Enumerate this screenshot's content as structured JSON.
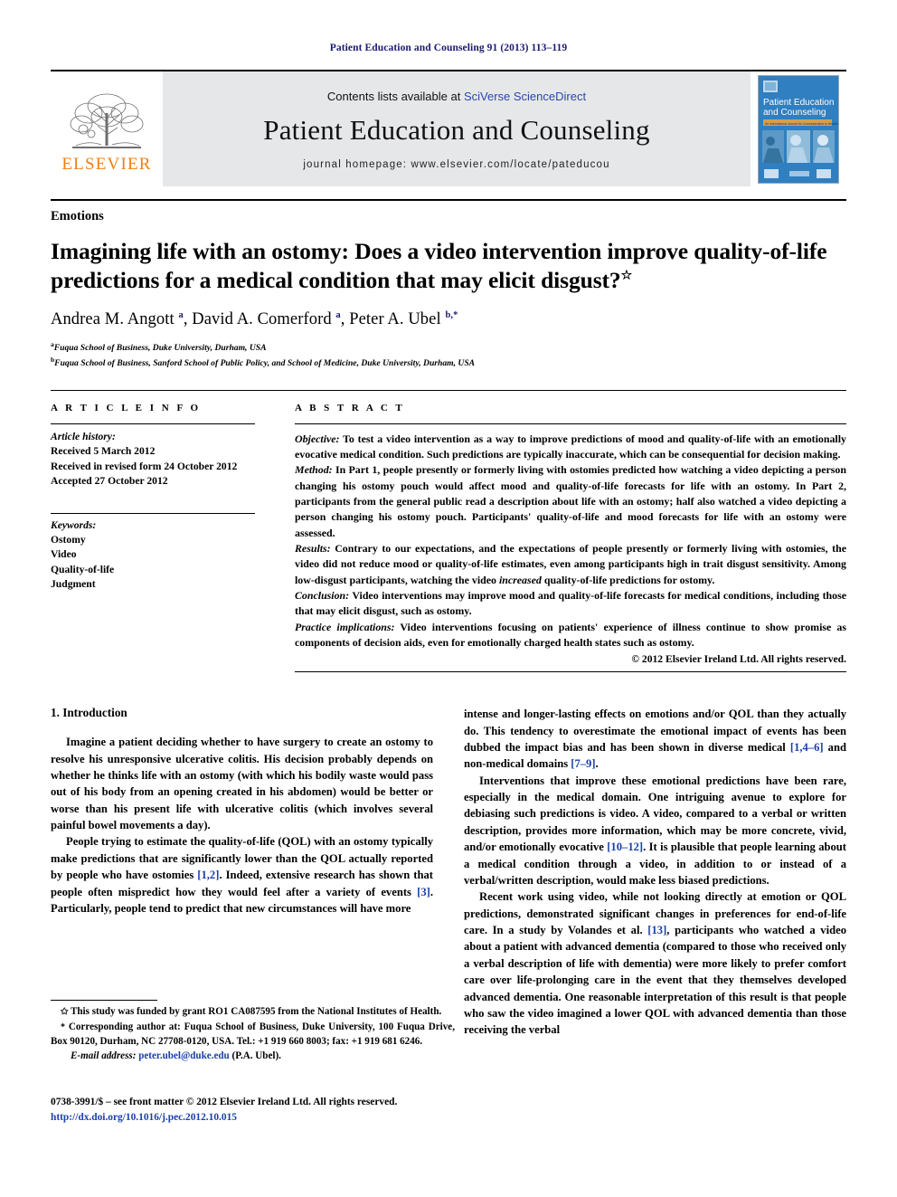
{
  "running_head": "Patient Education and Counseling 91 (2013) 113–119",
  "masthead": {
    "contents_prefix": "Contents lists available at ",
    "sciencedirect": "SciVerse ScienceDirect",
    "journal_title": "Patient Education and Counseling",
    "homepage": "journal homepage: www.elsevier.com/locate/pateducou",
    "publisher_logo_text": "ELSEVIER",
    "cover_title_line1": "Patient Education",
    "cover_title_line2": "and Counseling",
    "cover_subtitle": "An International Journal for Communication in Healthcare"
  },
  "article": {
    "section_label": "Emotions",
    "title": "Imagining life with an ostomy: Does a video intervention improve quality-of-life predictions for a medical condition that may elicit disgust?",
    "title_footnote_marker": "☆",
    "authors_html": "Andrea M. Angott <sup>a</sup>, David A. Comerford <sup>a</sup>, Peter A. Ubel <sup>b,*</sup>",
    "affiliations": [
      {
        "marker": "a",
        "text": "Fuqua School of Business, Duke University, Durham, USA"
      },
      {
        "marker": "b",
        "text": "Fuqua School of Business, Sanford School of Public Policy, and School of Medicine, Duke University, Durham, USA"
      }
    ]
  },
  "article_info": {
    "heading": "A R T I C L E   I N F O",
    "history_label": "Article history:",
    "history": [
      "Received 5 March 2012",
      "Received in revised form 24 October 2012",
      "Accepted 27 October 2012"
    ],
    "keywords_label": "Keywords:",
    "keywords": [
      "Ostomy",
      "Video",
      "Quality-of-life",
      "Judgment"
    ]
  },
  "abstract": {
    "heading": "A B S T R A C T",
    "sections": [
      {
        "label": "Objective:",
        "text": " To test a video intervention as a way to improve predictions of mood and quality-of-life with an emotionally evocative medical condition. Such predictions are typically inaccurate, which can be consequential for decision making."
      },
      {
        "label": "Method:",
        "text": " In Part 1, people presently or formerly living with ostomies predicted how watching a video depicting a person changing his ostomy pouch would affect mood and quality-of-life forecasts for life with an ostomy. In Part 2, participants from the general public read a description about life with an ostomy; half also watched a video depicting a person changing his ostomy pouch. Participants' quality-of-life and mood forecasts for life with an ostomy were assessed."
      },
      {
        "label": "Results:",
        "text": " Contrary to our expectations, and the expectations of people presently or formerly living with ostomies, the video did not reduce mood or quality-of-life estimates, even among participants high in trait disgust sensitivity. Among low-disgust participants, watching the video increased quality-of-life predictions for ostomy.",
        "emphasis": "increased"
      },
      {
        "label": "Conclusion:",
        "text": " Video interventions may improve mood and quality-of-life forecasts for medical conditions, including those that may elicit disgust, such as ostomy."
      },
      {
        "label": "Practice implications:",
        "text": " Video interventions focusing on patients' experience of illness continue to show promise as components of decision aids, even for emotionally charged health states such as ostomy."
      }
    ],
    "copyright": "© 2012 Elsevier Ireland Ltd. All rights reserved."
  },
  "body": {
    "heading": "1. Introduction",
    "left_paragraphs": [
      "Imagine a patient deciding whether to have surgery to create an ostomy to resolve his unresponsive ulcerative colitis. His decision probably depends on whether he thinks life with an ostomy (with which his bodily waste would pass out of his body from an opening created in his abdomen) would be better or worse than his present life with ulcerative colitis (which involves several painful bowel movements a day).",
      "People trying to estimate the quality-of-life (QOL) with an ostomy typically make predictions that are significantly lower than the QOL actually reported by people who have ostomies [1,2]. Indeed, extensive research has shown that people often mispredict how they would feel after a variety of events [3]. Particularly, people tend to predict that new circumstances will have more"
    ],
    "right_paragraphs": [
      "intense and longer-lasting effects on emotions and/or QOL than they actually do. This tendency to overestimate the emotional impact of events has been dubbed the impact bias and has been shown in diverse medical [1,4–6] and non-medical domains [7–9].",
      "Interventions that improve these emotional predictions have been rare, especially in the medical domain. One intriguing avenue to explore for debiasing such predictions is video. A video, compared to a verbal or written description, provides more information, which may be more concrete, vivid, and/or emotionally evocative [10–12]. It is plausible that people learning about a medical condition through a video, in addition to or instead of a verbal/written description, would make less biased predictions.",
      "Recent work using video, while not looking directly at emotion or QOL predictions, demonstrated significant changes in preferences for end-of-life care. In a study by Volandes et al. [13], participants who watched a video about a patient with advanced dementia (compared to those who received only a verbal description of life with dementia) were more likely to prefer comfort care over life-prolonging care in the event that they themselves developed advanced dementia. One reasonable interpretation of this result is that people who saw the video imagined a lower QOL with advanced dementia than those receiving the verbal"
    ]
  },
  "footnotes": {
    "funding": "This study was funded by grant RO1 CA087595 from the National Institutes of Health.",
    "funding_marker": "✩",
    "corresponding_marker": "*",
    "corresponding": "Corresponding author at: Fuqua School of Business, Duke University, 100 Fuqua Drive, Box 90120, Durham, NC 27708-0120, USA. Tel.: +1 919 660 8003; fax: +1 919 681 6246.",
    "email_label": "E-mail address:",
    "email": "peter.ubel@duke.edu",
    "email_owner": "(P.A. Ubel)."
  },
  "imprint": {
    "line1": "0738-3991/$ – see front matter © 2012 Elsevier Ireland Ltd. All rights reserved.",
    "doi": "http://dx.doi.org/10.1016/j.pec.2012.10.015"
  },
  "colors": {
    "running_head": "#1a1a6e",
    "link": "#2a48a8",
    "reference": "#1a3faa",
    "elsevier_orange": "#f07f13",
    "masthead_bg": "#e6e7e9",
    "cover_blue": "#2f7fc1"
  }
}
